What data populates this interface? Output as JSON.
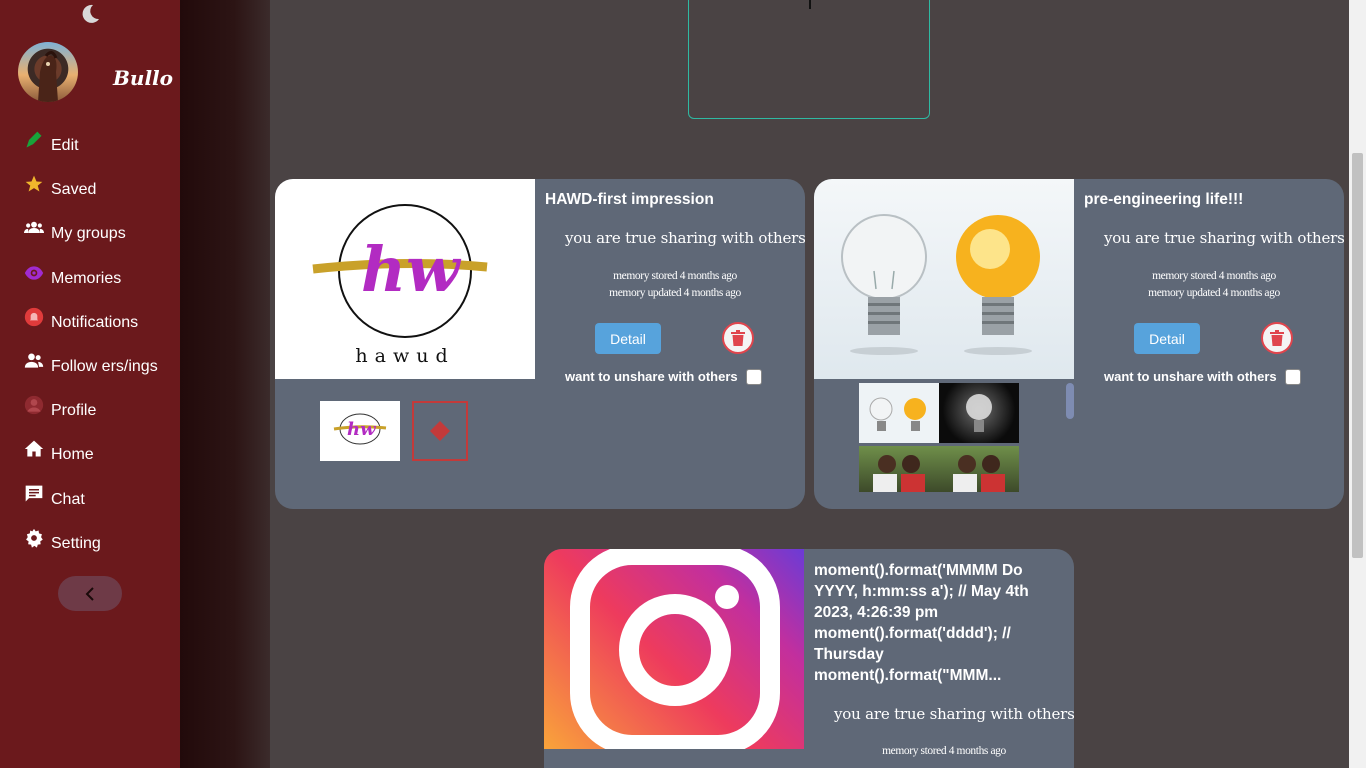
{
  "user": {
    "name": "Bullo"
  },
  "sidebar": {
    "items": [
      {
        "label": "Edit",
        "icon": "pencil-icon"
      },
      {
        "label": "Saved",
        "icon": "star-icon"
      },
      {
        "label": "My groups",
        "icon": "groups-icon"
      },
      {
        "label": "Memories",
        "icon": "eye-icon"
      },
      {
        "label": "Notifications",
        "icon": "bell-icon"
      },
      {
        "label": "Follow ers/ings",
        "icon": "people-icon"
      },
      {
        "label": "Profile",
        "icon": "person-icon"
      },
      {
        "label": "Home",
        "icon": "home-icon"
      },
      {
        "label": "Chat",
        "icon": "chat-icon"
      },
      {
        "label": "Setting",
        "icon": "gear-icon"
      }
    ],
    "collapse_icon": "chevron-left-icon"
  },
  "cards": [
    {
      "title": "HAWD-first impression",
      "share_text": "you are true sharing with others",
      "stored": "memory stored 4 months ago",
      "updated": "memory updated 4 months ago",
      "detail_label": "Detail",
      "unshare_label": "want to unshare with others",
      "logo_text": "hawud"
    },
    {
      "title": "pre-engineering life!!!",
      "share_text": "you are true sharing with others",
      "stored": "memory stored 4 months ago",
      "updated": "memory updated 4 months ago",
      "detail_label": "Detail",
      "unshare_label": "want to unshare with others"
    },
    {
      "title": "moment().format('MMMM Do YYYY, h:mm:ss a'); // May 4th 2023, 4:26:39 pm moment().format('dddd'); // Thursday moment().format(\"MMM...",
      "share_text": "you are true sharing with others",
      "stored": "memory stored 4 months ago"
    }
  ],
  "colors": {
    "sidebar": "#6b191c",
    "card": "#5f6877",
    "detail_button": "#57a3dc",
    "delete_ring": "#e0454d"
  }
}
